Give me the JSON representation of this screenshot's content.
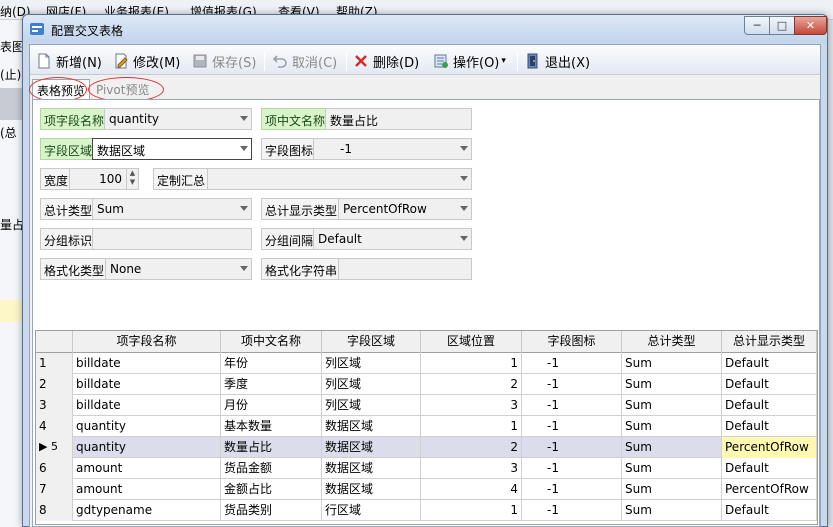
{
  "background_app": {
    "menu": [
      "纳(D)",
      "网店(F)",
      "业务报表(E)",
      "增值报表(G)",
      "查看(V)",
      "帮助(Z)"
    ],
    "side_texts": [
      "表图报",
      "(止)",
      "(总",
      "量占比"
    ]
  },
  "dialog": {
    "title": "配置交叉表格",
    "min": "─",
    "max": "□",
    "close": "✕"
  },
  "toolbar": {
    "new_label": "新增(N)",
    "edit_label": "修改(M)",
    "save_label": "保存(S)",
    "cancel_label": "取消(C)",
    "delete_label": "删除(D)",
    "operate_label": "操作(O)",
    "operate_caret": "▾",
    "exit_label": "退出(X)"
  },
  "tabs": {
    "table_preview": "表格预览",
    "pivot_preview": "Pivot预览"
  },
  "form": {
    "field_name_label": "项字段名称",
    "field_name_value": "quantity",
    "cn_name_label": "项中文名称",
    "cn_name_value": "数量占比",
    "area_label": "字段区域",
    "area_value": "数据区域",
    "icon_label": "字段图标",
    "icon_value": "-1",
    "width_label": "宽度",
    "width_value": "100",
    "custom_total_label": "定制汇总",
    "custom_total_value": "",
    "total_type_label": "总计类型",
    "total_type_value": "Sum",
    "total_display_label": "总计显示类型",
    "total_display_value": "PercentOfRow",
    "group_id_label": "分组标识",
    "group_id_value": "",
    "group_interval_label": "分组间隔",
    "group_interval_value": "Default",
    "format_type_label": "格式化类型",
    "format_type_value": "None",
    "format_string_label": "格式化字符串",
    "format_string_value": ""
  },
  "grid": {
    "columns": [
      "",
      "项字段名称",
      "项中文名称",
      "字段区域",
      "区域位置",
      "字段图标",
      "总计类型",
      "总计显示类型"
    ],
    "current_row_marker": "▶",
    "rows": [
      {
        "n": "1",
        "field": "billdate",
        "cn": "年份",
        "area": "列区域",
        "pos": "1",
        "icon": "-1",
        "total": "Sum",
        "display": "Default"
      },
      {
        "n": "2",
        "field": "billdate",
        "cn": "季度",
        "area": "列区域",
        "pos": "2",
        "icon": "-1",
        "total": "Sum",
        "display": "Default"
      },
      {
        "n": "3",
        "field": "billdate",
        "cn": "月份",
        "area": "列区域",
        "pos": "3",
        "icon": "-1",
        "total": "Sum",
        "display": "Default"
      },
      {
        "n": "4",
        "field": "quantity",
        "cn": "基本数量",
        "area": "数据区域",
        "pos": "1",
        "icon": "-1",
        "total": "Sum",
        "display": "Default"
      },
      {
        "n": "5",
        "field": "quantity",
        "cn": "数量占比",
        "area": "数据区域",
        "pos": "2",
        "icon": "-1",
        "total": "Sum",
        "display": "PercentOfRow"
      },
      {
        "n": "6",
        "field": "amount",
        "cn": "货品金额",
        "area": "数据区域",
        "pos": "3",
        "icon": "-1",
        "total": "Sum",
        "display": "Default"
      },
      {
        "n": "7",
        "field": "amount",
        "cn": "金额占比",
        "area": "数据区域",
        "pos": "4",
        "icon": "-1",
        "total": "Sum",
        "display": "PercentOfRow"
      },
      {
        "n": "8",
        "field": "gdtypename",
        "cn": "货品类别",
        "area": "行区域",
        "pos": "1",
        "icon": "-1",
        "total": "Sum",
        "display": "Default"
      }
    ],
    "selected_row": 5
  },
  "colors": {
    "label_green": "#d8f5c9",
    "highlight_yellow": "#fff8b0",
    "selected_row": "#dcdcec",
    "annotation_red": "#dd3333"
  }
}
